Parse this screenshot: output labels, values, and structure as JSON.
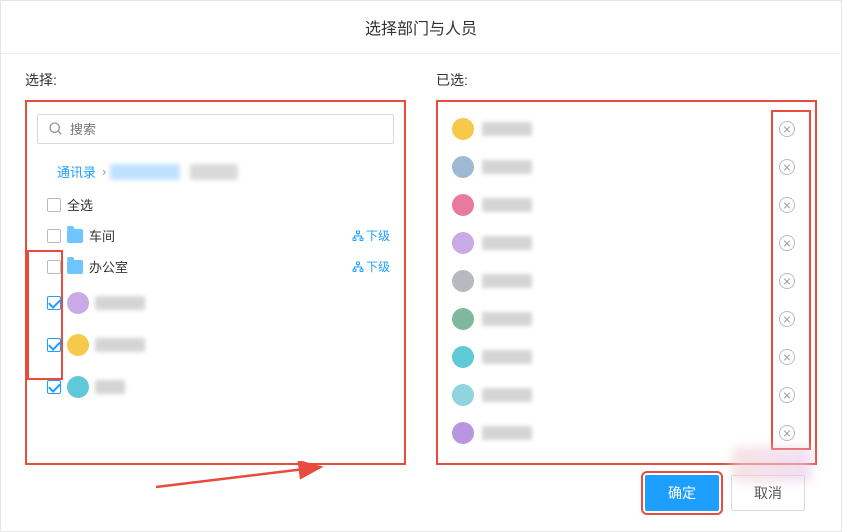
{
  "dialog_title": "选择部门与人员",
  "left": {
    "label": "选择:",
    "search_placeholder": "搜索",
    "breadcrumb_root": "通讯录",
    "select_all": "全选",
    "departments": [
      {
        "name": "车间",
        "drill": "下级"
      },
      {
        "name": "办公室",
        "drill": "下级"
      }
    ],
    "people": [
      {
        "avatar_color": "#c9a9e6",
        "checked": true
      },
      {
        "avatar_color": "#f5c94a",
        "checked": true
      },
      {
        "avatar_color": "#5fc9d8",
        "checked": true
      }
    ]
  },
  "right": {
    "label": "已选:",
    "items": [
      {
        "avatar_color": "#f5c94a"
      },
      {
        "avatar_color": "#9fb8d4"
      },
      {
        "avatar_color": "#e87aa0"
      },
      {
        "avatar_color": "#c9a9e6"
      },
      {
        "avatar_color": "#b8b8c0"
      },
      {
        "avatar_color": "#7fb89f"
      },
      {
        "avatar_color": "#5fc9d8"
      },
      {
        "avatar_color": "#8fd4de"
      },
      {
        "avatar_color": "#b896e0"
      }
    ]
  },
  "buttons": {
    "ok": "确定",
    "cancel": "取消"
  }
}
